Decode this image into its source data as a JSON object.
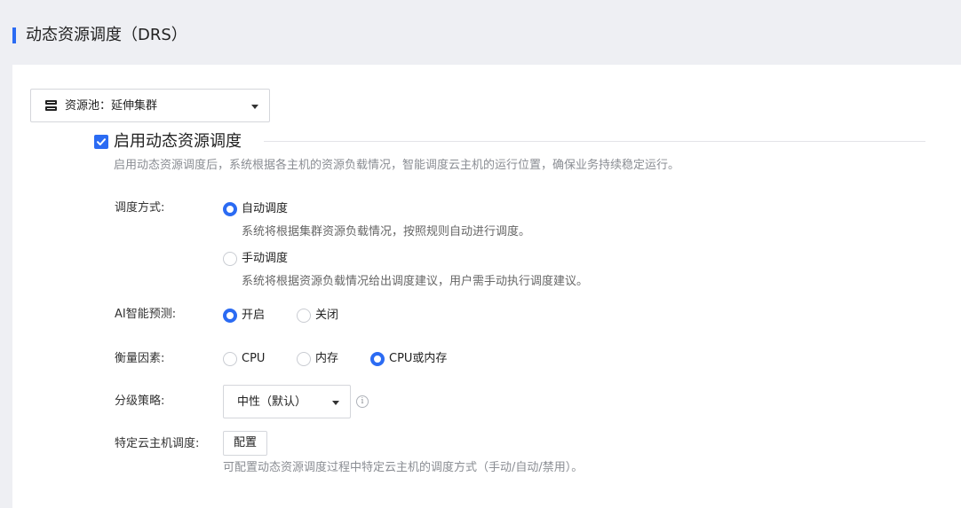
{
  "header": {
    "title": "动态资源调度（DRS）"
  },
  "pool": {
    "label": "资源池：延伸集群"
  },
  "enable": {
    "label": "启用动态资源调度",
    "checked": true,
    "description": "启用动态资源调度后，系统根据各主机的资源负载情况，智能调度云主机的运行位置，确保业务持续稳定运行。"
  },
  "schedule_mode": {
    "label": "调度方式:",
    "options": [
      {
        "label": "自动调度",
        "checked": true,
        "description": "系统将根据集群资源负载情况，按照规则自动进行调度。"
      },
      {
        "label": "手动调度",
        "checked": false,
        "description": "系统将根据资源负载情况给出调度建议，用户需手动执行调度建议。"
      }
    ]
  },
  "ai_prediction": {
    "label": "AI智能预测:",
    "options": [
      {
        "label": "开启",
        "checked": true
      },
      {
        "label": "关闭",
        "checked": false
      }
    ]
  },
  "metric": {
    "label": "衡量因素:",
    "options": [
      {
        "label": "CPU",
        "checked": false
      },
      {
        "label": "内存",
        "checked": false
      },
      {
        "label": "CPU或内存",
        "checked": true
      }
    ]
  },
  "strategy": {
    "label": "分级策略:",
    "value": "中性（默认）",
    "info_glyph": "i"
  },
  "specific_vm": {
    "label": "特定云主机调度:",
    "button_label": "配置",
    "description": "可配置动态资源调度过程中特定云主机的调度方式（手动/自动/禁用）。"
  },
  "colors": {
    "accent": "#2b6bf3",
    "background": "#eeeff3",
    "panel": "#ffffff"
  },
  "icons": {
    "pool": "server-icon",
    "enable": "checkbox-checked-icon",
    "strategy_info": "info-icon"
  }
}
